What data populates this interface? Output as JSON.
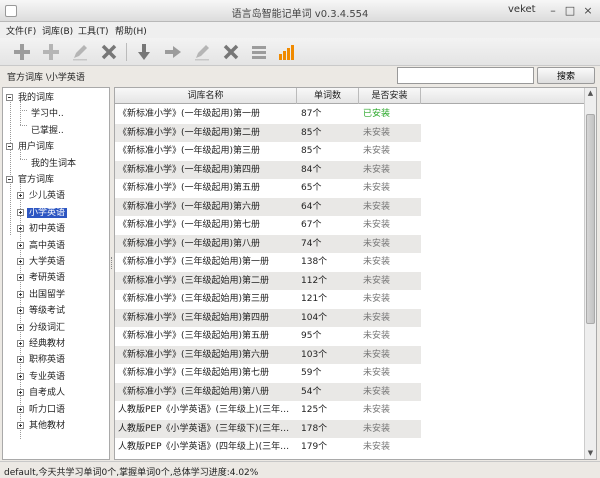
{
  "window": {
    "title": "语言岛智能记单词 v0.3.4.554",
    "brand": "veket",
    "controls": [
      "minimize-icon",
      "maximize-icon",
      "close-icon"
    ]
  },
  "menu": [
    "文件(F)",
    "词库(B)",
    "工具(T)",
    "帮助(H)"
  ],
  "toolbar": {
    "icons": [
      "add-icon",
      "add-icon",
      "edit-icon",
      "delete-icon",
      "move-down-icon",
      "move-right-icon",
      "edit-icon",
      "delete-icon",
      "list-icon",
      "chart-icon"
    ],
    "colors": {
      "active": "#777777",
      "disabled": "#b5b5b5",
      "chart": "#f08a00"
    }
  },
  "path": "官方词库 \\小学英语",
  "search": {
    "value": "",
    "button": "搜索"
  },
  "tree": {
    "nodes": [
      {
        "label": "我的词库",
        "level": 0,
        "expander": "minus"
      },
      {
        "label": "学习中..",
        "level": 1
      },
      {
        "label": "已掌握..",
        "level": 1
      },
      {
        "label": "用户词库",
        "level": 0,
        "expander": "minus"
      },
      {
        "label": "我的生词本",
        "level": 1
      },
      {
        "label": "官方词库",
        "level": 0,
        "expander": "minus"
      },
      {
        "label": "少儿英语",
        "level": 1,
        "expander": "plus"
      },
      {
        "label": "小学英语",
        "level": 1,
        "expander": "plus",
        "selected": true
      },
      {
        "label": "初中英语",
        "level": 1,
        "expander": "plus"
      },
      {
        "label": "高中英语",
        "level": 1,
        "expander": "plus"
      },
      {
        "label": "大学英语",
        "level": 1,
        "expander": "plus"
      },
      {
        "label": "考研英语",
        "level": 1,
        "expander": "plus"
      },
      {
        "label": "出国留学",
        "level": 1,
        "expander": "plus"
      },
      {
        "label": "等级考试",
        "level": 1,
        "expander": "plus"
      },
      {
        "label": "分级词汇",
        "level": 1,
        "expander": "plus"
      },
      {
        "label": "经典教材",
        "level": 1,
        "expander": "plus"
      },
      {
        "label": "职称英语",
        "level": 1,
        "expander": "plus"
      },
      {
        "label": "专业英语",
        "level": 1,
        "expander": "plus"
      },
      {
        "label": "自考成人",
        "level": 1,
        "expander": "plus"
      },
      {
        "label": "听力口语",
        "level": 1,
        "expander": "plus"
      },
      {
        "label": "其他教材",
        "level": 1,
        "expander": "plus"
      }
    ],
    "selection_color": "#2d56c2"
  },
  "table": {
    "columns": [
      "词库名称",
      "单词数",
      "是否安装"
    ],
    "rows": [
      {
        "name": "《新标准小学》(一年级起用)第一册",
        "count": "87个",
        "status": "已安装",
        "installed": true
      },
      {
        "name": "《新标准小学》(一年级起用)第二册",
        "count": "85个",
        "status": "未安装"
      },
      {
        "name": "《新标准小学》(一年级起用)第三册",
        "count": "85个",
        "status": "未安装"
      },
      {
        "name": "《新标准小学》(一年级起用)第四册",
        "count": "84个",
        "status": "未安装"
      },
      {
        "name": "《新标准小学》(一年级起用)第五册",
        "count": "65个",
        "status": "未安装"
      },
      {
        "name": "《新标准小学》(一年级起用)第六册",
        "count": "64个",
        "status": "未安装"
      },
      {
        "name": "《新标准小学》(一年级起用)第七册",
        "count": "67个",
        "status": "未安装"
      },
      {
        "name": "《新标准小学》(一年级起用)第八册",
        "count": "74个",
        "status": "未安装"
      },
      {
        "name": "《新标准小学》(三年级起始用)第一册",
        "count": "138个",
        "status": "未安装"
      },
      {
        "name": "《新标准小学》(三年级起始用)第二册",
        "count": "112个",
        "status": "未安装"
      },
      {
        "name": "《新标准小学》(三年级起始用)第三册",
        "count": "121个",
        "status": "未安装"
      },
      {
        "name": "《新标准小学》(三年级起始用)第四册",
        "count": "104个",
        "status": "未安装"
      },
      {
        "name": "《新标准小学》(三年级起始用)第五册",
        "count": "95个",
        "status": "未安装"
      },
      {
        "name": "《新标准小学》(三年级起始用)第六册",
        "count": "103个",
        "status": "未安装"
      },
      {
        "name": "《新标准小学》(三年级起始用)第七册",
        "count": "59个",
        "status": "未安装"
      },
      {
        "name": "《新标准小学》(三年级起始用)第八册",
        "count": "54个",
        "status": "未安装"
      },
      {
        "name": "人教版PEP《小学英语》(三年级上)(三年级起…",
        "count": "125个",
        "status": "未安装"
      },
      {
        "name": "人教版PEP《小学英语》(三年级下)(三年级起…",
        "count": "178个",
        "status": "未安装"
      },
      {
        "name": "人教版PEP《小学英语》(四年级上)(三年级起…",
        "count": "179个",
        "status": "未安装"
      }
    ],
    "status_colors": {
      "installed": "#2aa72a",
      "not_installed": "#777777"
    }
  },
  "status_bar": "default,今天共学习单词0个,掌握单词0个,总体学习进度:4.02%"
}
